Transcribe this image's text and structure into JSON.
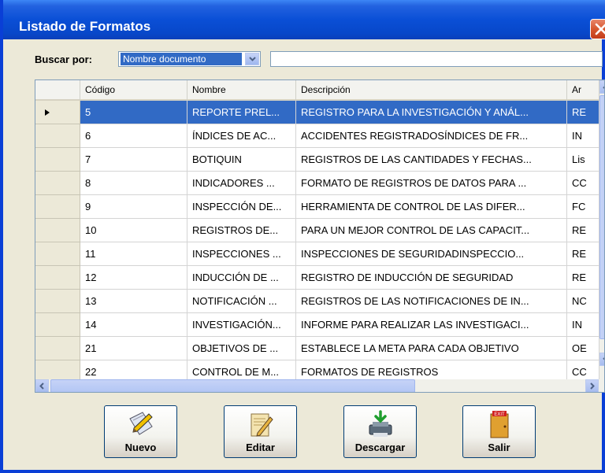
{
  "window": {
    "title": "Listado de Formatos"
  },
  "search": {
    "label": "Buscar por:",
    "field_selected": "Nombre documento",
    "query": ""
  },
  "grid": {
    "columns": [
      "Código",
      "Nombre",
      "Descripción",
      "Ar"
    ],
    "rows": [
      {
        "codigo": "5",
        "nombre": "REPORTE PREL...",
        "descripcion": "REGISTRO PARA LA INVESTIGACIÓN Y ANÁL...",
        "area": "RE"
      },
      {
        "codigo": "6",
        "nombre": "ÍNDICES DE AC...",
        "descripcion": "ACCIDENTES REGISTRADOSÍNDICES DE FR...",
        "area": "IN"
      },
      {
        "codigo": "7",
        "nombre": "BOTIQUIN",
        "descripcion": "REGISTROS DE LAS CANTIDADES Y FECHAS...",
        "area": "Lis"
      },
      {
        "codigo": "8",
        "nombre": "INDICADORES ...",
        "descripcion": "FORMATO DE REGISTROS DE DATOS PARA ...",
        "area": "CC"
      },
      {
        "codigo": "9",
        "nombre": "INSPECCIÓN DE...",
        "descripcion": "HERRAMIENTA DE CONTROL DE LAS DIFER...",
        "area": "FC"
      },
      {
        "codigo": "10",
        "nombre": "REGISTROS DE...",
        "descripcion": "PARA UN MEJOR CONTROL DE LAS CAPACIT...",
        "area": "RE"
      },
      {
        "codigo": "11",
        "nombre": "INSPECCIONES ...",
        "descripcion": "INSPECCIONES DE SEGURIDADINSPECCIO...",
        "area": "RE"
      },
      {
        "codigo": "12",
        "nombre": "INDUCCIÓN DE ...",
        "descripcion": "REGISTRO DE INDUCCIÓN DE SEGURIDAD",
        "area": "RE"
      },
      {
        "codigo": "13",
        "nombre": "NOTIFICACIÓN ...",
        "descripcion": "REGISTROS DE LAS NOTIFICACIONES DE IN...",
        "area": "NC"
      },
      {
        "codigo": "14",
        "nombre": "INVESTIGACIÓN...",
        "descripcion": "INFORME PARA REALIZAR LAS INVESTIGACI...",
        "area": "IN"
      },
      {
        "codigo": "21",
        "nombre": "OBJETIVOS DE ...",
        "descripcion": "ESTABLECE LA META PARA CADA OBJETIVO",
        "area": "OE"
      },
      {
        "codigo": "22",
        "nombre": "CONTROL DE M...",
        "descripcion": "FORMATOS DE REGISTROS",
        "area": "CC"
      }
    ],
    "selected_row": 0
  },
  "buttons": {
    "nuevo": "Nuevo",
    "editar": "Editar",
    "descargar": "Descargar",
    "salir": "Salir"
  },
  "icons": {
    "nuevo": "pencil-document-icon",
    "editar": "edit-pencil-icon",
    "descargar": "download-printer-icon",
    "salir": "exit-door-icon",
    "exit_sign_text": "EXIT"
  },
  "colors": {
    "selection": "#316ac5",
    "titlebar": "#0a4fd6",
    "window_bg": "#ece9d8"
  }
}
